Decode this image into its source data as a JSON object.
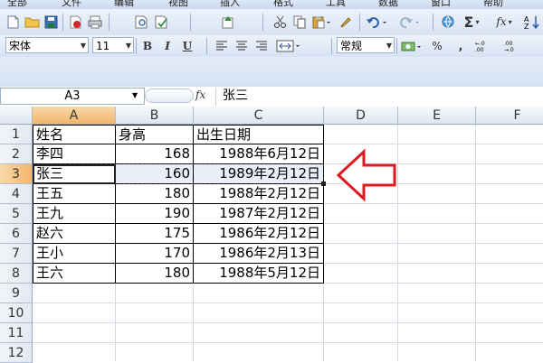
{
  "menu": [
    "全部",
    "文件",
    "编辑",
    "视图",
    "插入",
    "格式",
    "工具",
    "数据",
    "窗口",
    "帮助"
  ],
  "toolbar1": {
    "icons": [
      "new-file-icon",
      "open-folder-icon",
      "save-icon",
      "pdf-icon",
      "print-icon",
      "print-preview-icon",
      "spellcheck-icon",
      "research-icon",
      "cut-icon",
      "copy-icon",
      "paste-icon",
      "format-painter-icon",
      "undo-icon",
      "redo-icon",
      "hyperlink-icon",
      "autosum-icon",
      "function-icon",
      "sort-icon"
    ],
    "glyphs": {
      "autosum": "Σ",
      "function": "fx"
    }
  },
  "toolbar2": {
    "font_name": "宋体",
    "font_size": "11",
    "bold": "B",
    "italic": "I",
    "underline": "U",
    "number_format": "常规",
    "percent": "%",
    "comma": ","
  },
  "formula_bar": {
    "name_box": "A3",
    "fx_label": "fx",
    "content": "张三"
  },
  "columns": [
    "A",
    "B",
    "C",
    "D",
    "E",
    "F"
  ],
  "rows": [
    "1",
    "2",
    "3",
    "4",
    "5",
    "6",
    "7",
    "8",
    "9",
    "10",
    "11",
    "12"
  ],
  "table": {
    "header": [
      "姓名",
      "身高",
      "出生日期"
    ],
    "data": [
      [
        "李四",
        "168",
        "1988年6月12日"
      ],
      [
        "张三",
        "160",
        "1989年2月12日"
      ],
      [
        "王五",
        "180",
        "1988年2月12日"
      ],
      [
        "王九",
        "190",
        "1987年2月12日"
      ],
      [
        "赵六",
        "175",
        "1986年2月12日"
      ],
      [
        "王小",
        "170",
        "1986年2月13日"
      ],
      [
        "王六",
        "180",
        "1988年5月12日"
      ]
    ]
  },
  "selected_cell": "A3",
  "colors": {
    "arrow": "#e0191f",
    "selection": "#f3b56a"
  }
}
